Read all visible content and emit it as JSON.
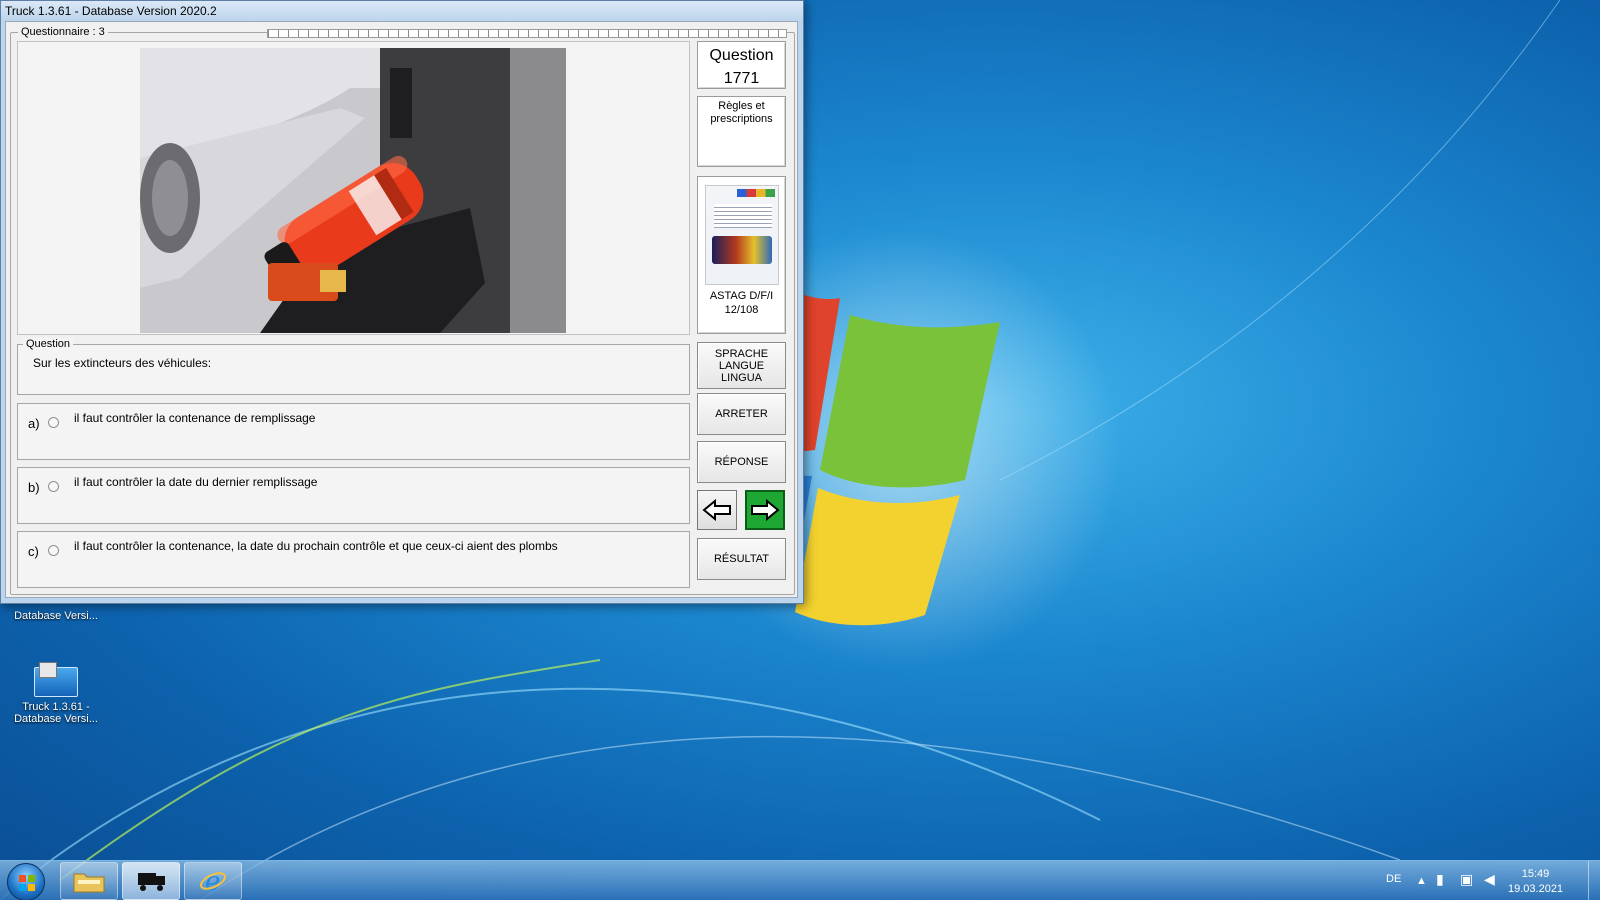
{
  "window": {
    "title": "Truck 1.3.61 - Database Version 2020.2",
    "questionnaire_label": "Questionnaire : 3"
  },
  "question_panel": {
    "legend": "Question",
    "text": "Sur les extincteurs des véhicules:",
    "answers": [
      {
        "letter": "a)",
        "text": "il faut contrôler la contenance de remplissage",
        "selected": false
      },
      {
        "letter": "b)",
        "text": "il faut contrôler la date du dernier remplissage",
        "selected": false
      },
      {
        "letter": "c)",
        "text": "il faut contrôler la contenance, la date du prochain contrôle et que ceux-ci aient des plombs",
        "selected": false
      }
    ]
  },
  "sidebar": {
    "question_label": "Question",
    "question_number": "1771",
    "rules_line1": "Règles et",
    "rules_line2": "prescriptions",
    "book_caption_line1": "ASTAG D/F/I",
    "book_caption_line2": "12/108",
    "language_button": [
      "SPRACHE",
      "LANGUE",
      "LINGUA"
    ],
    "stop_button": "ARRETER",
    "answer_button": "RÉPONSE",
    "result_button": "RÉSULTAT"
  },
  "desktop": {
    "icon_partial_label": "Database Versi...",
    "icon_label_line1": "Truck 1.3.61 -",
    "icon_label_line2": "Database Versi..."
  },
  "taskbar": {
    "language": "DE",
    "time": "15:49",
    "date": "19.03.2021"
  },
  "colors": {
    "next_button": "#1ea733",
    "desktop_blue": "#1b87cf"
  }
}
